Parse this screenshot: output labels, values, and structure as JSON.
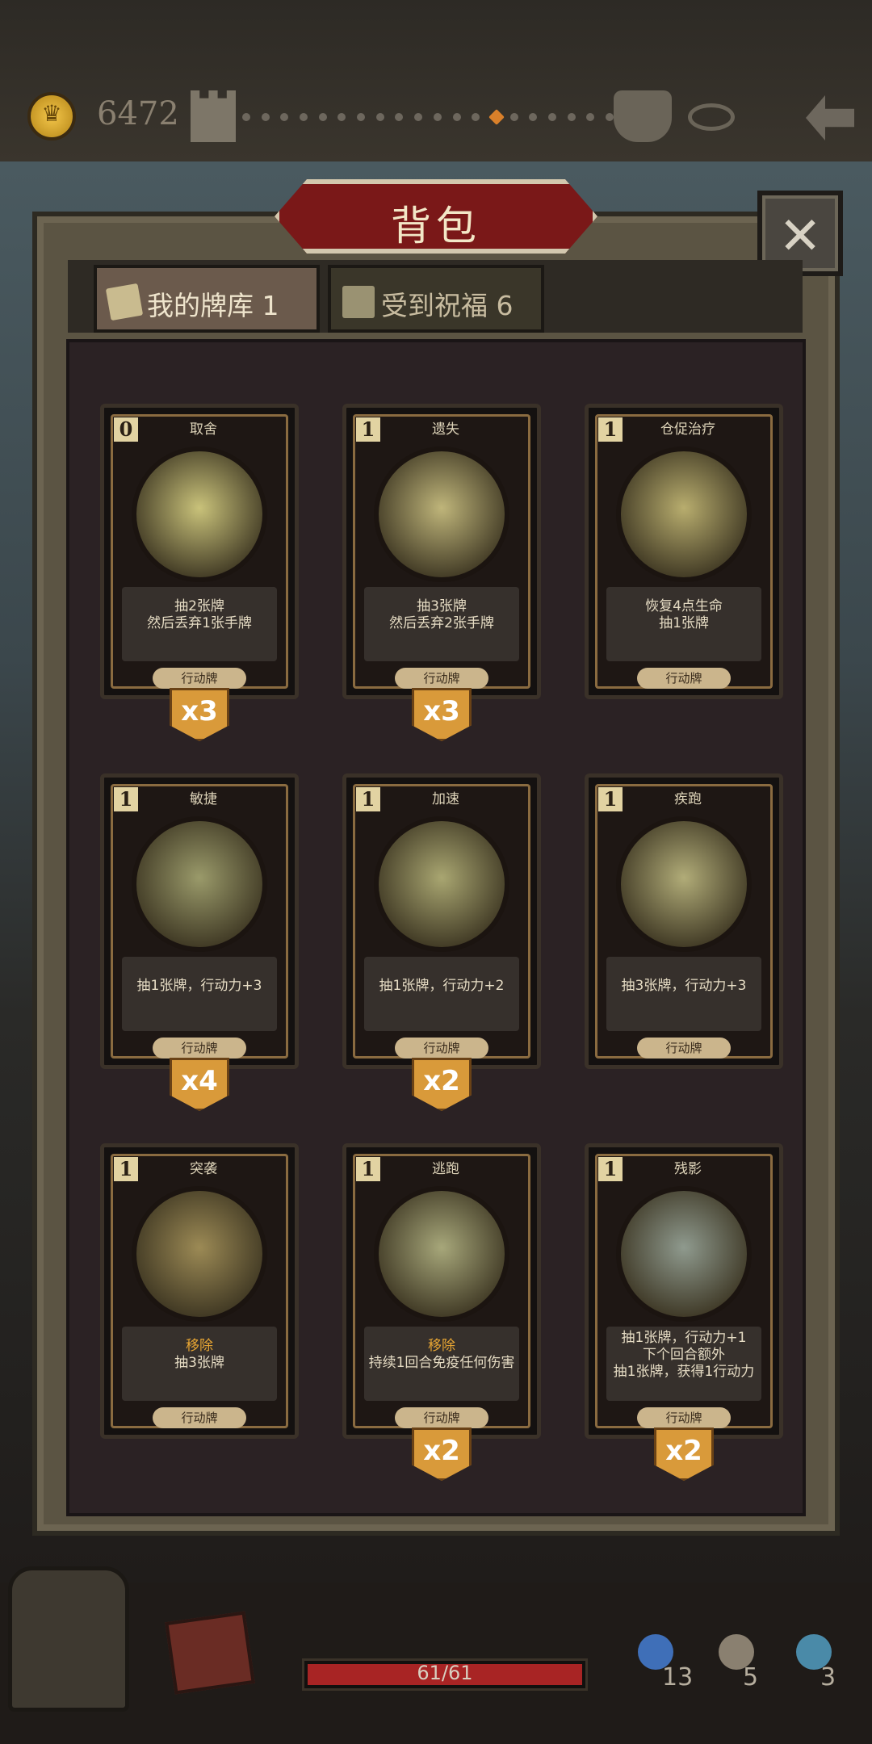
{
  "hud": {
    "gold": "6472",
    "progress_total": 20,
    "progress_current": 13
  },
  "panel": {
    "title": "背包",
    "close_glyph": "✕",
    "tabs": [
      {
        "label": "我的牌库 1",
        "icon": "cards-icon",
        "active": true
      },
      {
        "label": "受到祝福 6",
        "icon": "gift-icon",
        "active": false
      }
    ]
  },
  "cards": [
    {
      "cost": "0",
      "name": "取舍",
      "lines": [
        "抽2张牌",
        "然后丢弃1张手牌"
      ],
      "highlight": "",
      "type": "行动牌",
      "count": "x3",
      "art": "#c9c27a"
    },
    {
      "cost": "1",
      "name": "遗失",
      "lines": [
        "抽3张牌",
        "然后丢弃2张手牌"
      ],
      "highlight": "",
      "type": "行动牌",
      "count": "x3",
      "art": "#bfb57a"
    },
    {
      "cost": "1",
      "name": "仓促治疗",
      "lines": [
        "恢复4点生命",
        "抽1张牌"
      ],
      "highlight": "",
      "type": "行动牌",
      "count": "",
      "art": "#b8ad6e"
    },
    {
      "cost": "1",
      "name": "敏捷",
      "lines": [
        "抽1张牌，行动力+3"
      ],
      "highlight": "",
      "type": "行动牌",
      "count": "x4",
      "art": "#9a9a6a"
    },
    {
      "cost": "1",
      "name": "加速",
      "lines": [
        "抽1张牌，行动力+2"
      ],
      "highlight": "",
      "type": "行动牌",
      "count": "x2",
      "art": "#a9a671"
    },
    {
      "cost": "1",
      "name": "疾跑",
      "lines": [
        "抽3张牌，行动力+3"
      ],
      "highlight": "",
      "type": "行动牌",
      "count": "",
      "art": "#b1ac78"
    },
    {
      "cost": "1",
      "name": "突袭",
      "lines": [
        "抽3张牌"
      ],
      "highlight": "移除",
      "type": "行动牌",
      "count": "",
      "art": "#9c8a55"
    },
    {
      "cost": "1",
      "name": "逃跑",
      "lines": [
        "持续1回合免疫任何伤害"
      ],
      "highlight": "移除",
      "type": "行动牌",
      "count": "x2",
      "art": "#a7a77a"
    },
    {
      "cost": "1",
      "name": "残影",
      "lines": [
        "抽1张牌，行动力+1",
        "下个回合额外",
        "抽1张牌，获得1行动力"
      ],
      "highlight": "",
      "type": "行动牌",
      "count": "x2",
      "art": "#8f9a8e"
    }
  ],
  "footer": {
    "hp_text": "61/61",
    "hp_fraction": 1.0,
    "stats": [
      {
        "icon": "orb-icon",
        "value": "13",
        "color": "#3f6fb8"
      },
      {
        "icon": "hourglass-icon",
        "value": "5",
        "color": "#8a8070"
      },
      {
        "icon": "cards-stack-icon",
        "value": "3",
        "color": "#4a8aa8"
      }
    ]
  }
}
